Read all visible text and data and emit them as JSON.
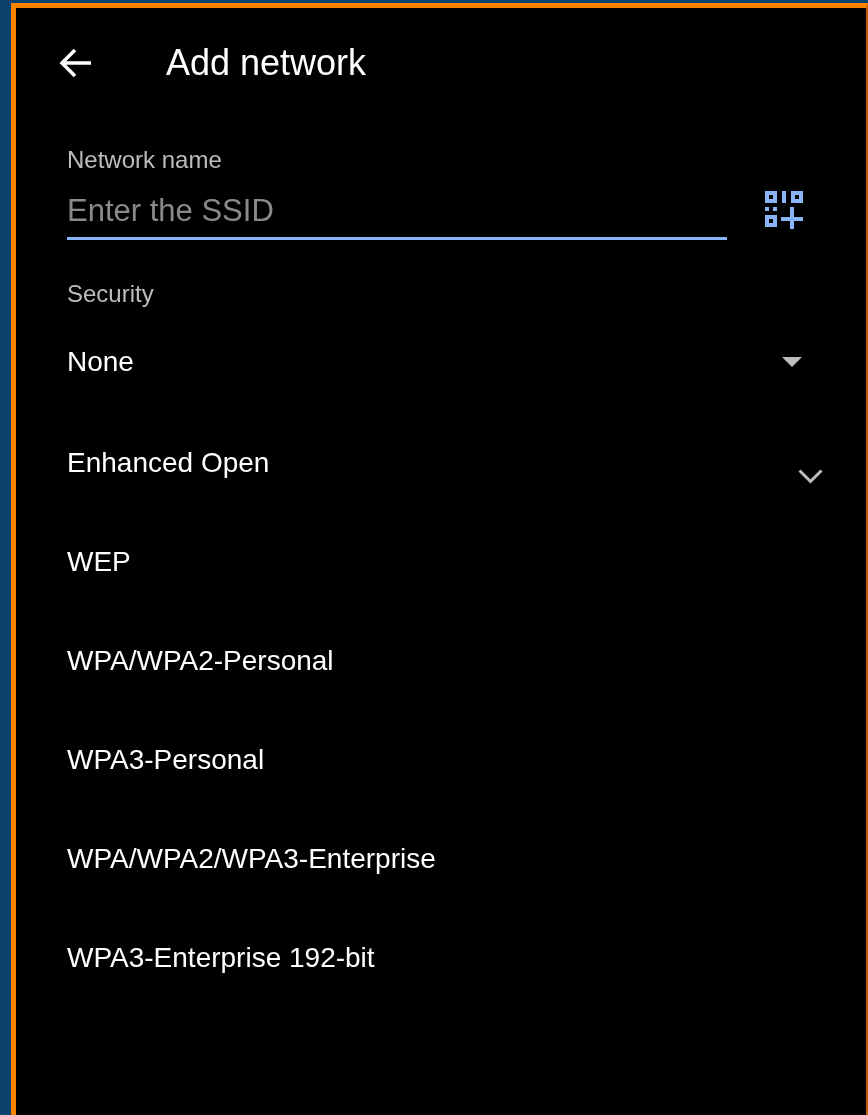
{
  "header": {
    "title": "Add network"
  },
  "network_name": {
    "label": "Network name",
    "placeholder": "Enter the SSID"
  },
  "security": {
    "label": "Security",
    "value": "None",
    "options": [
      "Enhanced Open",
      "WEP",
      "WPA/WPA2-Personal",
      "WPA3-Personal",
      "WPA/WPA2/WPA3-Enterprise",
      "WPA3-Enterprise 192-bit"
    ]
  }
}
